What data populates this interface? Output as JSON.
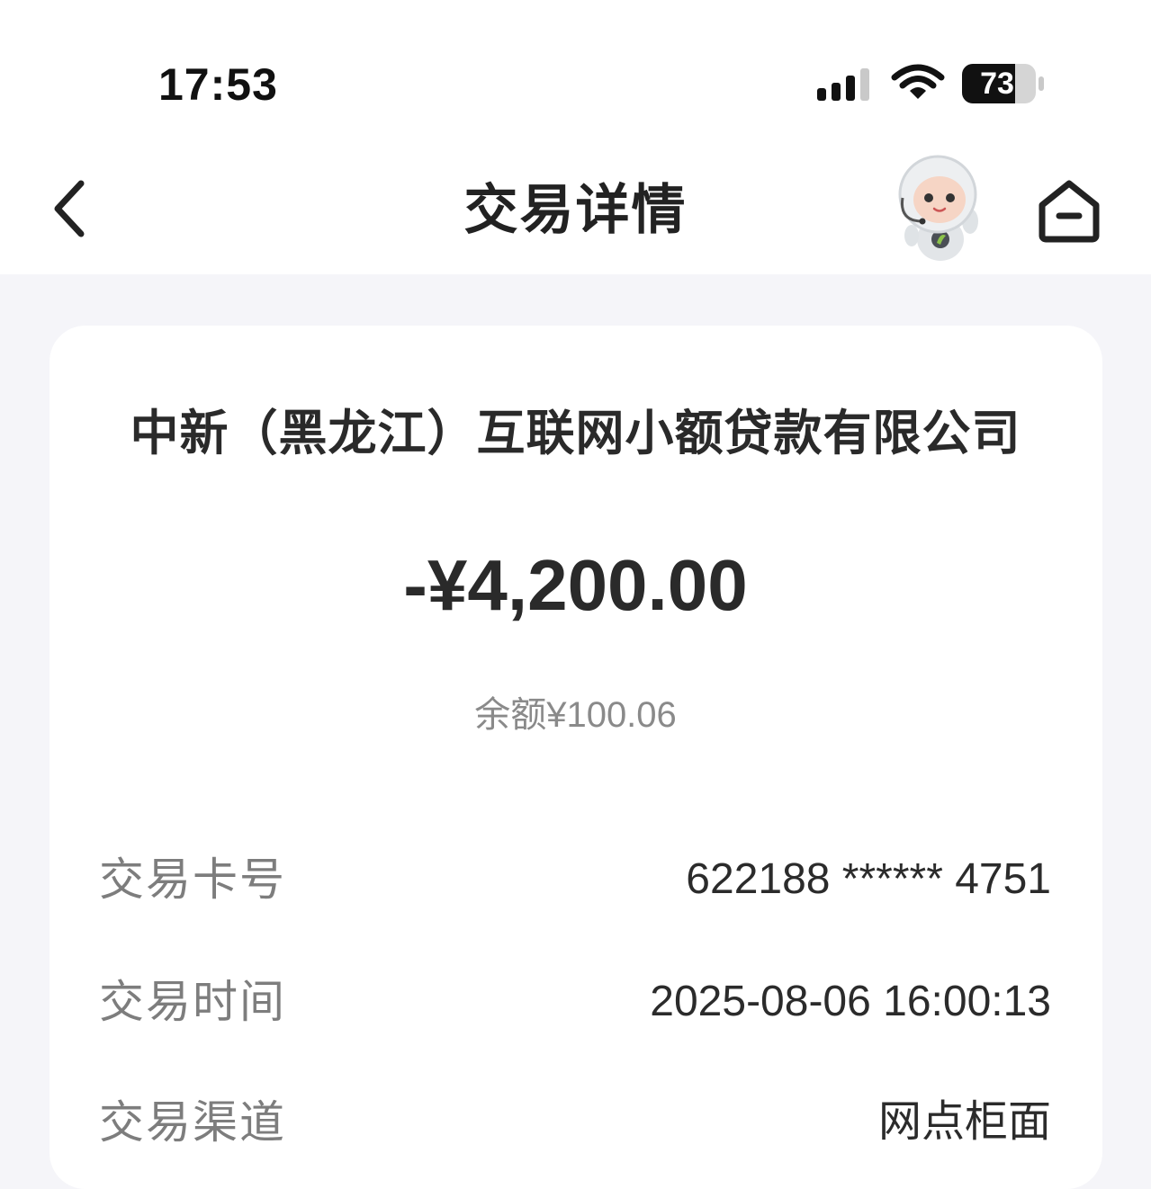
{
  "status_bar": {
    "time": "17:53",
    "battery": "73",
    "icons": [
      "signal-icon",
      "wifi-icon",
      "battery-icon"
    ]
  },
  "nav": {
    "title": "交易详情",
    "back_icon": "chevron-left-icon",
    "assistant_icon": "robot-mascot-icon",
    "home_icon": "home-icon"
  },
  "transaction": {
    "counterparty": "中新（黑龙江）互联网小额贷款有限公司",
    "amount": "-¥4,200.00",
    "balance": "余额¥100.06",
    "details": [
      {
        "label": "交易卡号",
        "value": "622188 ****** 4751"
      },
      {
        "label": "交易时间",
        "value": "2025-08-06 16:00:13"
      },
      {
        "label": "交易渠道",
        "value": "网点柜面"
      }
    ]
  },
  "colors": {
    "page_bg": "#f5f5f9",
    "card_bg": "#ffffff",
    "text_primary": "#2a2a2a",
    "text_secondary": "#8a8a8a"
  }
}
